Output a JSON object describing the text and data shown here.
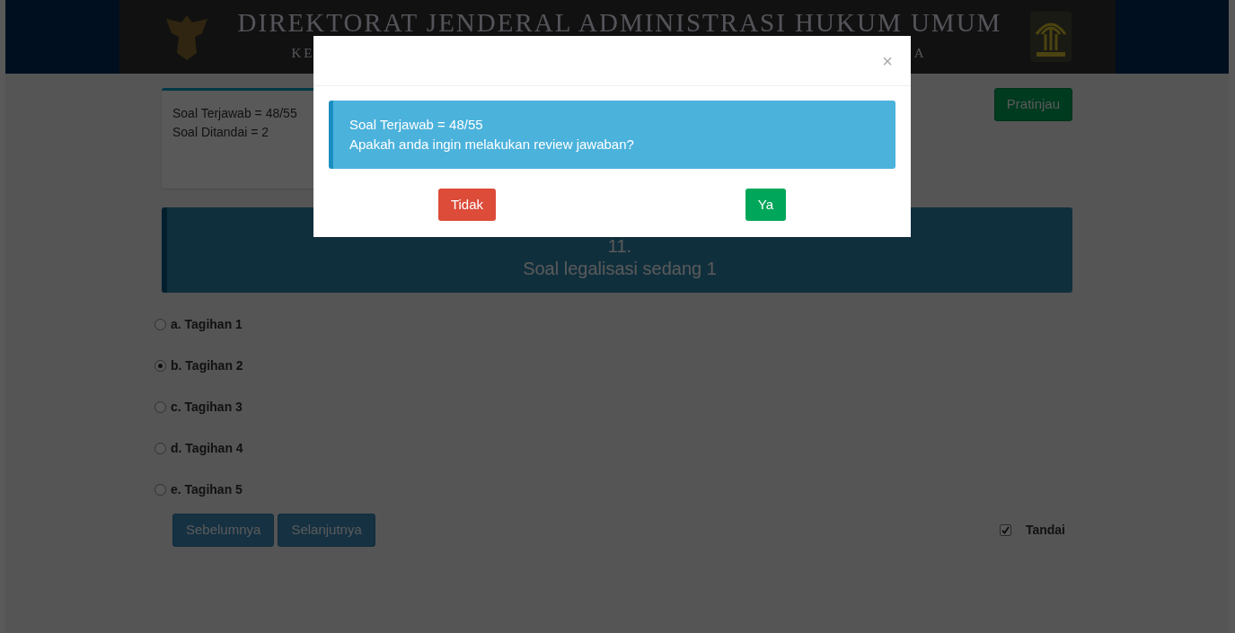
{
  "header": {
    "title": "DIREKTORAT JENDERAL ADMINISTRASI HUKUM UMUM",
    "subtitle_parts": [
      "KE",
      "A"
    ]
  },
  "summary": {
    "lines": [
      "Soal Terjawab = 48/55",
      "Soal Ditandai = 2"
    ]
  },
  "preview_button": "Pratinjau",
  "question": {
    "number": "11.",
    "text": "Soal legalisasi sedang 1"
  },
  "options": [
    {
      "label": "a. Tagihan 1",
      "selected": false
    },
    {
      "label": "b. Tagihan 2",
      "selected": true
    },
    {
      "label": "c. Tagihan 3",
      "selected": false
    },
    {
      "label": "d. Tagihan 4",
      "selected": false
    },
    {
      "label": "e. Tagihan 5",
      "selected": false
    }
  ],
  "nav_buttons": [
    "Sebelumnya",
    "Selanjutnya"
  ],
  "mark": {
    "label": "Tandai",
    "checked": true
  },
  "modal": {
    "close": "×",
    "message_lines": [
      "Soal Terjawab = 48/55",
      "Apakah anda ingin melakukan review jawaban?"
    ],
    "buttons": [
      {
        "label": "Tidak",
        "kind": "danger"
      },
      {
        "label": "Ya",
        "kind": "success"
      }
    ]
  }
}
